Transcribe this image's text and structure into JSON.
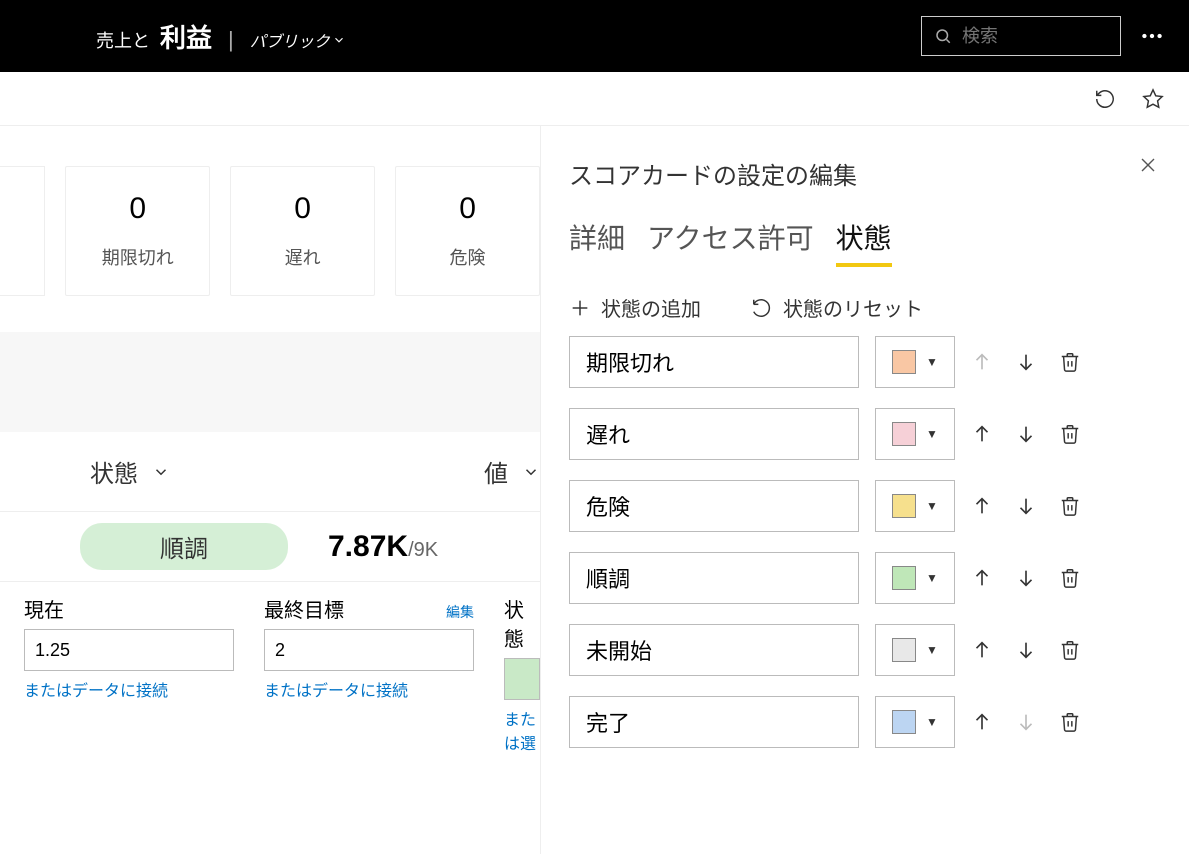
{
  "topbar": {
    "title_pre": "売上と",
    "title_main": "利益",
    "scope": "パブリック",
    "search_placeholder": "検索"
  },
  "cards": [
    {
      "value": "0",
      "label": "期限切れ"
    },
    {
      "value": "0",
      "label": "遅れ"
    },
    {
      "value": "0",
      "label": "危険"
    }
  ],
  "columns": {
    "state": "状態",
    "value": "値"
  },
  "row": {
    "pill": "順調",
    "value": "7.87K",
    "value_suffix": "/9K"
  },
  "editors": {
    "current_label": "現在",
    "current_value": "1.25",
    "target_label": "最終目標",
    "target_value": "2",
    "edit": "編集",
    "connect": "またはデータに接続",
    "status_label": "状態",
    "or_select": "または選"
  },
  "panel": {
    "title": "スコアカードの設定の編集",
    "tabs": {
      "detail": "詳細",
      "permission": "アクセス許可",
      "state": "状態"
    },
    "add_state": "状態の追加",
    "reset_state": "状態のリセット",
    "statuses": [
      {
        "label": "期限切れ",
        "color": "#f9c7a4",
        "up_disabled": true,
        "down_disabled": false
      },
      {
        "label": "遅れ",
        "color": "#f6d0d7",
        "up_disabled": false,
        "down_disabled": false
      },
      {
        "label": "危険",
        "color": "#f6e08d",
        "up_disabled": false,
        "down_disabled": false
      },
      {
        "label": "順調",
        "color": "#bfe7b8",
        "up_disabled": false,
        "down_disabled": false
      },
      {
        "label": "未開始",
        "color": "#e8e8e8",
        "up_disabled": false,
        "down_disabled": false
      },
      {
        "label": "完了",
        "color": "#bcd5f2",
        "up_disabled": false,
        "down_disabled": true
      }
    ]
  }
}
